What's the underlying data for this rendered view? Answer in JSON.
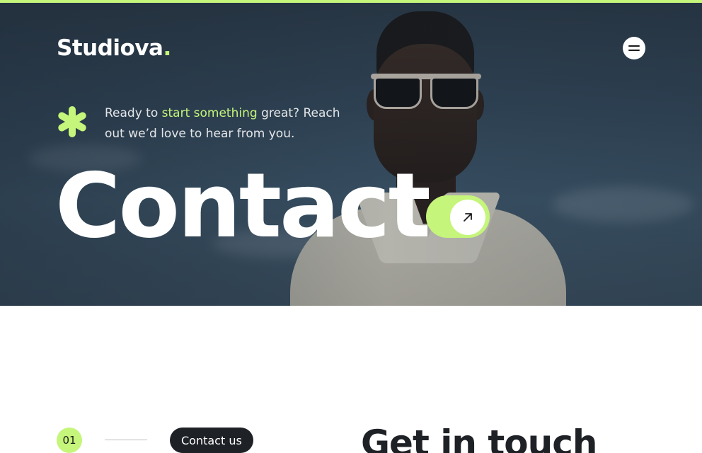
{
  "brand": {
    "name": "Studiova",
    "dot": "."
  },
  "nav": {
    "menu_icon": "hamburger-icon"
  },
  "hero": {
    "tagline_pre": "Ready to ",
    "tagline_highlight": "start something",
    "tagline_post": " great? Reach out  we’d love to hear from you.",
    "title": "Contact",
    "toggle_icon": "arrow-up-right-icon",
    "star_icon": "asterisk-icon"
  },
  "section": {
    "step_number": "01",
    "pill_label": "Contact us",
    "title": "Get in touch"
  },
  "colors": {
    "accent": "#c5f57a",
    "dark": "#1e2126",
    "white": "#ffffff"
  }
}
